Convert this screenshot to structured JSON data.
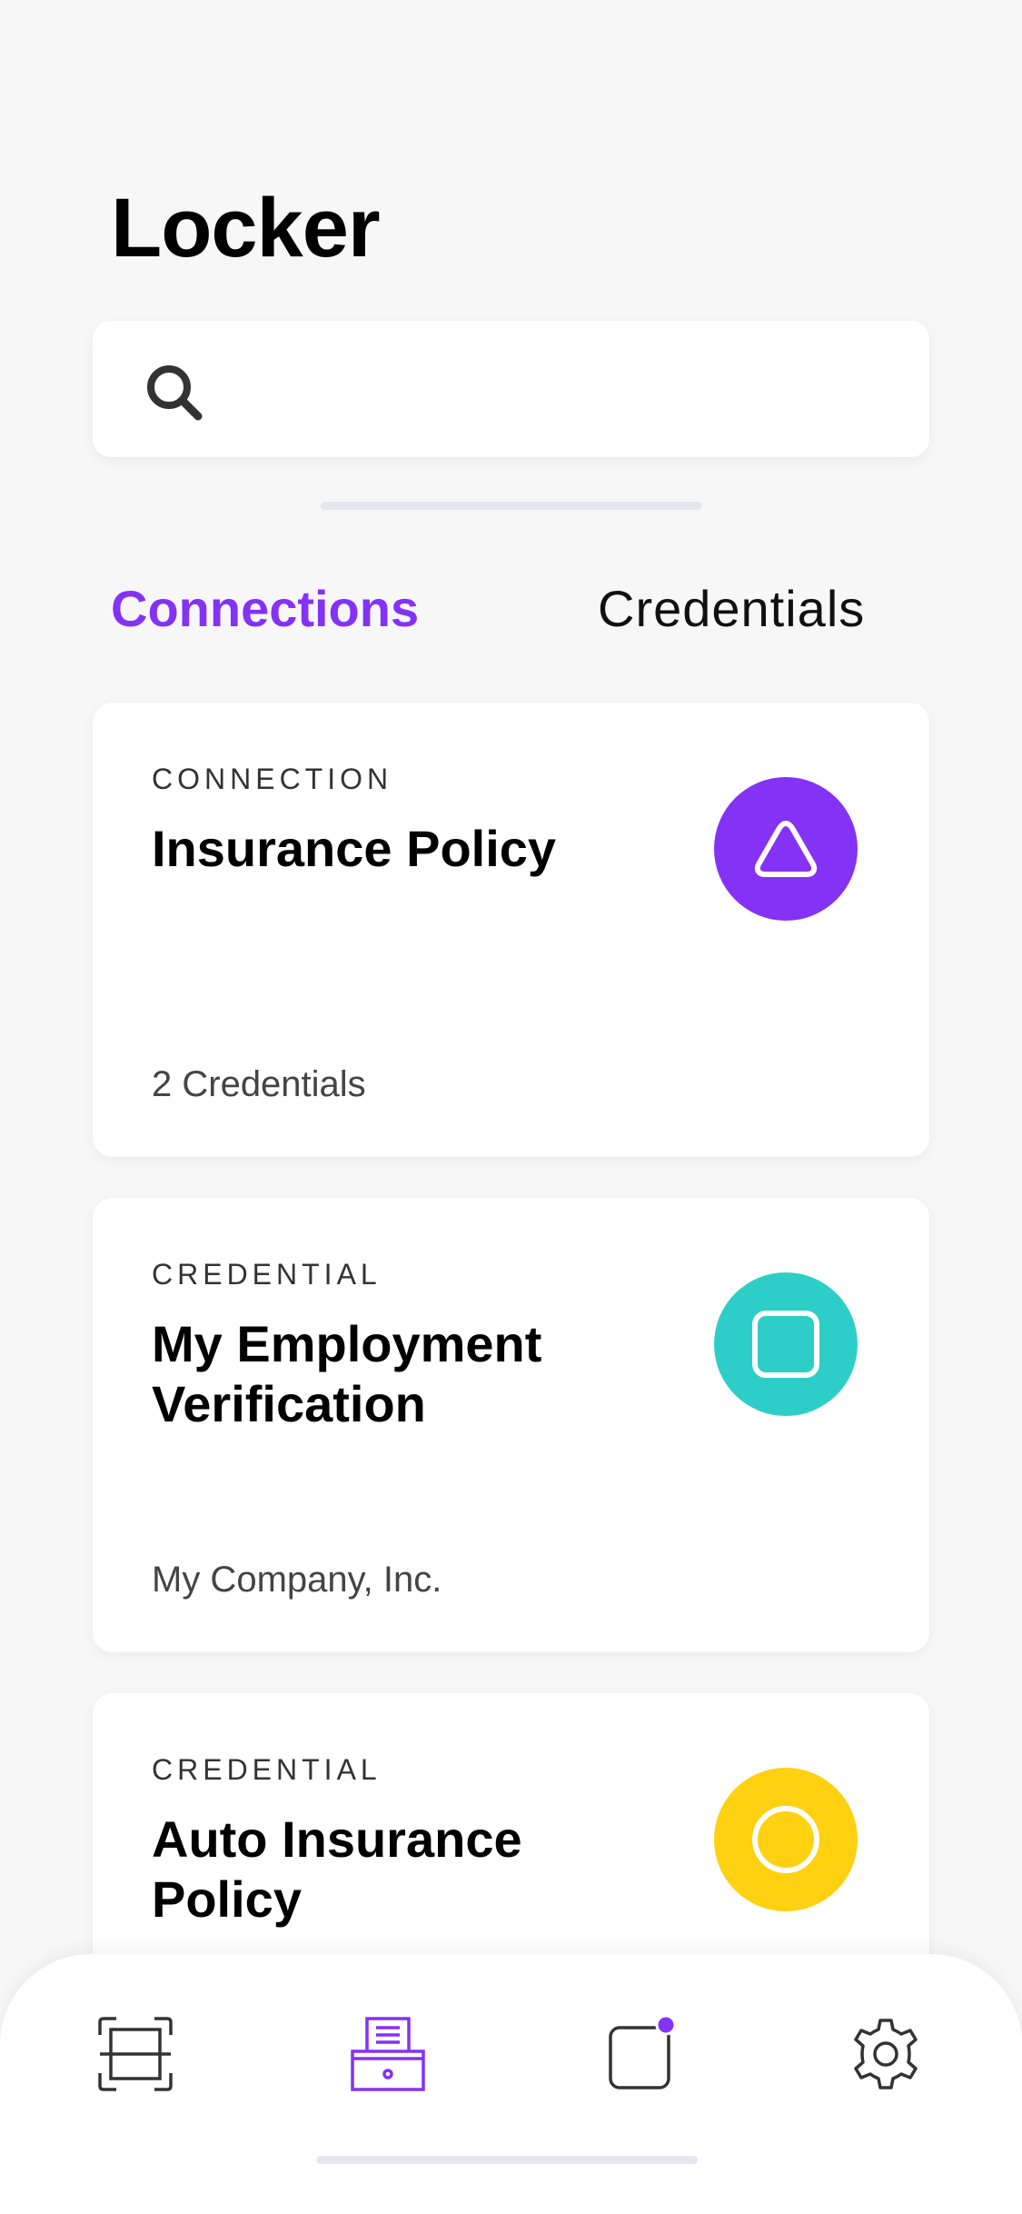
{
  "header": {
    "title": "Locker"
  },
  "search": {
    "placeholder": "",
    "value": "",
    "icon": "search-icon"
  },
  "tabs": [
    {
      "label": "Connections",
      "active": true
    },
    {
      "label": "Credentials",
      "active": false
    }
  ],
  "cards": [
    {
      "kind": "CONNECTION",
      "title": "Insurance Policy",
      "subtitle": "2 Credentials",
      "icon": "triangle-icon",
      "color": "#8432f5"
    },
    {
      "kind": "CREDENTIAL",
      "title": "My Employment Verification",
      "subtitle": "My Company, Inc.",
      "icon": "square-icon",
      "color": "#2ecec8"
    },
    {
      "kind": "CREDENTIAL",
      "title": "Auto Insurance Policy",
      "subtitle": "",
      "icon": "circle-icon",
      "color": "#ffd110"
    }
  ],
  "bottom_nav": [
    {
      "name": "scan",
      "icon": "scan-icon",
      "active": false
    },
    {
      "name": "locker",
      "icon": "locker-icon",
      "active": true
    },
    {
      "name": "notifications",
      "icon": "notification-icon",
      "active": false,
      "has_badge": true
    },
    {
      "name": "settings",
      "icon": "gear-icon",
      "active": false
    }
  ],
  "colors": {
    "accent": "#8432f5",
    "background": "#f7f7f8",
    "icon_default": "#333333"
  }
}
